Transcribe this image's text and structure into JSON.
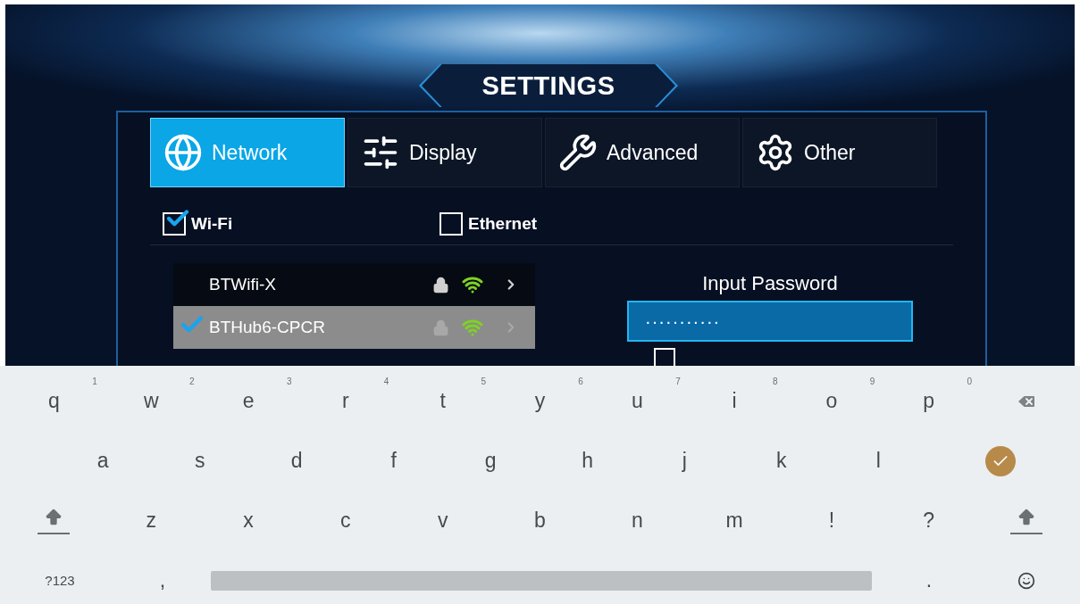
{
  "title": "SETTINGS",
  "tabs": [
    {
      "label": "Network",
      "selected": true
    },
    {
      "label": "Display",
      "selected": false
    },
    {
      "label": "Advanced",
      "selected": false
    },
    {
      "label": "Other",
      "selected": false
    }
  ],
  "connections": [
    {
      "label": "Wi-Fi",
      "checked": true
    },
    {
      "label": "Ethernet",
      "checked": false
    }
  ],
  "networks": [
    {
      "name": "BTWifi-X",
      "checked": false,
      "selected": false
    },
    {
      "name": "BTHub6-CPCR",
      "checked": true,
      "selected": true
    }
  ],
  "password": {
    "label": "Input Password",
    "value": "···········",
    "show_password_checked": false
  },
  "keyboard": [
    [
      {
        "kind": "letter",
        "label": "q",
        "hint": "1"
      },
      {
        "kind": "letter",
        "label": "w",
        "hint": "2"
      },
      {
        "kind": "letter",
        "label": "e",
        "hint": "3"
      },
      {
        "kind": "letter",
        "label": "r",
        "hint": "4"
      },
      {
        "kind": "letter",
        "label": "t",
        "hint": "5"
      },
      {
        "kind": "letter",
        "label": "y",
        "hint": "6"
      },
      {
        "kind": "letter",
        "label": "u",
        "hint": "7"
      },
      {
        "kind": "letter",
        "label": "i",
        "hint": "8"
      },
      {
        "kind": "letter",
        "label": "o",
        "hint": "9"
      },
      {
        "kind": "letter",
        "label": "p",
        "hint": "0"
      },
      {
        "kind": "backspace"
      }
    ],
    [
      {
        "kind": "gap"
      },
      {
        "kind": "letter",
        "label": "a"
      },
      {
        "kind": "letter",
        "label": "s"
      },
      {
        "kind": "letter",
        "label": "d"
      },
      {
        "kind": "letter",
        "label": "f"
      },
      {
        "kind": "letter",
        "label": "g"
      },
      {
        "kind": "letter",
        "label": "h"
      },
      {
        "kind": "letter",
        "label": "j"
      },
      {
        "kind": "letter",
        "label": "k"
      },
      {
        "kind": "letter",
        "label": "l"
      },
      {
        "kind": "enter"
      }
    ],
    [
      {
        "kind": "shift"
      },
      {
        "kind": "letter",
        "label": "z"
      },
      {
        "kind": "letter",
        "label": "x"
      },
      {
        "kind": "letter",
        "label": "c"
      },
      {
        "kind": "letter",
        "label": "v"
      },
      {
        "kind": "letter",
        "label": "b"
      },
      {
        "kind": "letter",
        "label": "n"
      },
      {
        "kind": "letter",
        "label": "m"
      },
      {
        "kind": "letter",
        "label": "!"
      },
      {
        "kind": "letter",
        "label": "?"
      },
      {
        "kind": "shift"
      }
    ],
    [
      {
        "kind": "mode",
        "label": "?123"
      },
      {
        "kind": "letter",
        "label": ","
      },
      {
        "kind": "space"
      },
      {
        "kind": "letter",
        "label": "."
      },
      {
        "kind": "emoji"
      }
    ]
  ]
}
